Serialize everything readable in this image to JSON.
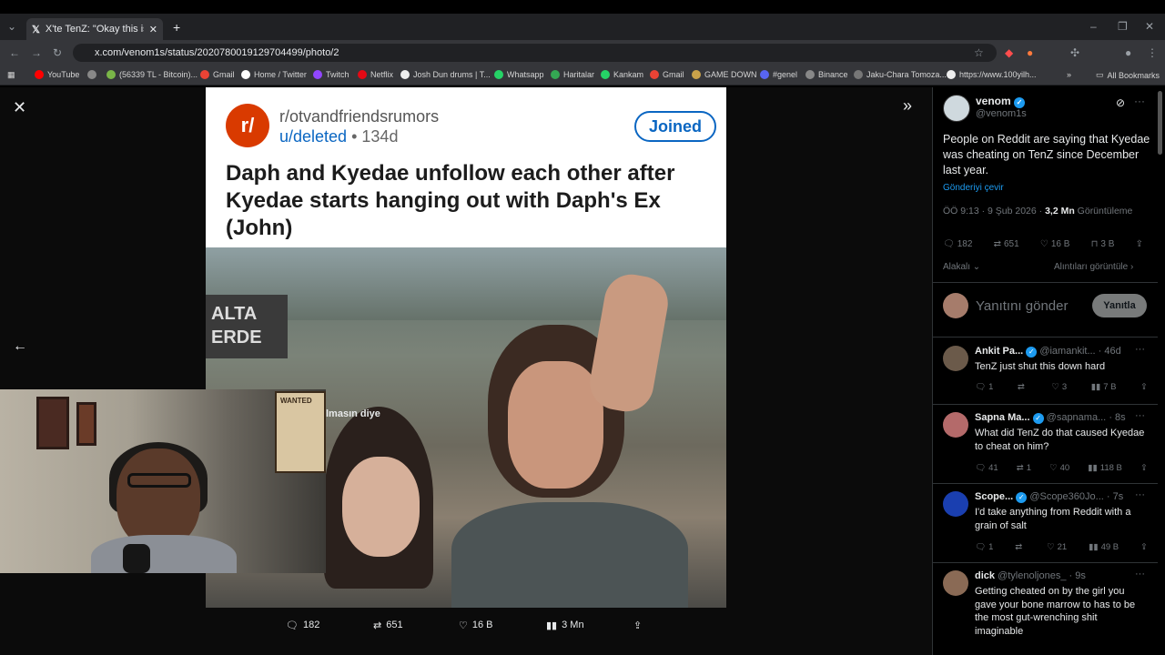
{
  "browser": {
    "tab_title": "X'te TenZ: \"Okay this is genuine",
    "url": "x.com/venom1s/status/2020780019129704499/photo/2",
    "new_tab_symbol": "+",
    "bookmarks": [
      "YouTube",
      "(56339 TL - Bitcoin)...",
      "Gmail",
      "Home / Twitter",
      "Twitch",
      "Netflix",
      "Josh Dun drums | T...",
      "Whatsapp",
      "Haritalar",
      "Kankam",
      "Gmail",
      "GAME DOWN",
      "#genel",
      "Binance",
      "Jaku-Chara Tomoza...",
      "https://www.100yilh..."
    ],
    "all_bookmarks": "All Bookmarks"
  },
  "reddit": {
    "logo": "r/",
    "subreddit": "r/otvandfriendsrumors",
    "user": "u/deleted",
    "age": "134d",
    "joined": "Joined",
    "headline": "Daph and Kyedae unfollow each other after Kyedae starts hanging out with Daph's Ex (John)",
    "sign_text": "ALTA\nERDE"
  },
  "media_stats": {
    "replies": "182",
    "reposts": "651",
    "likes": "16 B",
    "views": "3 Mn"
  },
  "overlay_text": "lmasın diye",
  "webcam": {
    "poster_text": "WANTED"
  },
  "post": {
    "author_name": "venom",
    "author_handle": "@venom1s",
    "text": "People on Reddit are saying that Kyedae was cheating on TenZ since December last year.",
    "translate": "Gönderiyi çevir",
    "time": "ÖÖ 9:13 · 9 Şub 2026 · ",
    "views_count": "3,2 Mn",
    "views_label": " Görüntüleme",
    "replies": "182",
    "reposts": "651",
    "likes": "16 B",
    "bookmarks": "3 B",
    "related": "Alakalı",
    "quotes": "Alıntıları görüntüle",
    "reply_placeholder": "Yanıtını gönder",
    "reply_button": "Yanıtla"
  },
  "replies": [
    {
      "name": "Ankit Pa...",
      "handle": "@iamankit...",
      "time": "· 46d",
      "text": "TenZ just shut this down hard",
      "replies": "1",
      "reposts": "",
      "likes": "3",
      "views": "7 B"
    },
    {
      "name": "Sapna Ma...",
      "handle": "@sapnama...",
      "time": "· 8s",
      "text": "What did TenZ do that caused Kyedae to cheat on him?",
      "replies": "41",
      "reposts": "1",
      "likes": "40",
      "views": "118 B"
    },
    {
      "name": "Scope...",
      "handle": "@Scope360Jo...",
      "time": "· 7s",
      "text": "I'd take anything from Reddit with a grain of salt",
      "replies": "1",
      "reposts": "",
      "likes": "21",
      "views": "49 B"
    },
    {
      "name": "dick",
      "handle": "@tylenoljones_",
      "time": "· 9s",
      "text": "Getting cheated on by the girl you gave your bone marrow to has to be the most gut-wrenching shit imaginable",
      "replies": "",
      "reposts": "",
      "likes": "",
      "views": ""
    }
  ],
  "colors": {
    "accent": "#1d9bf0",
    "reddit_orange": "#d93a00",
    "reddit_blue": "#0a66c2"
  }
}
